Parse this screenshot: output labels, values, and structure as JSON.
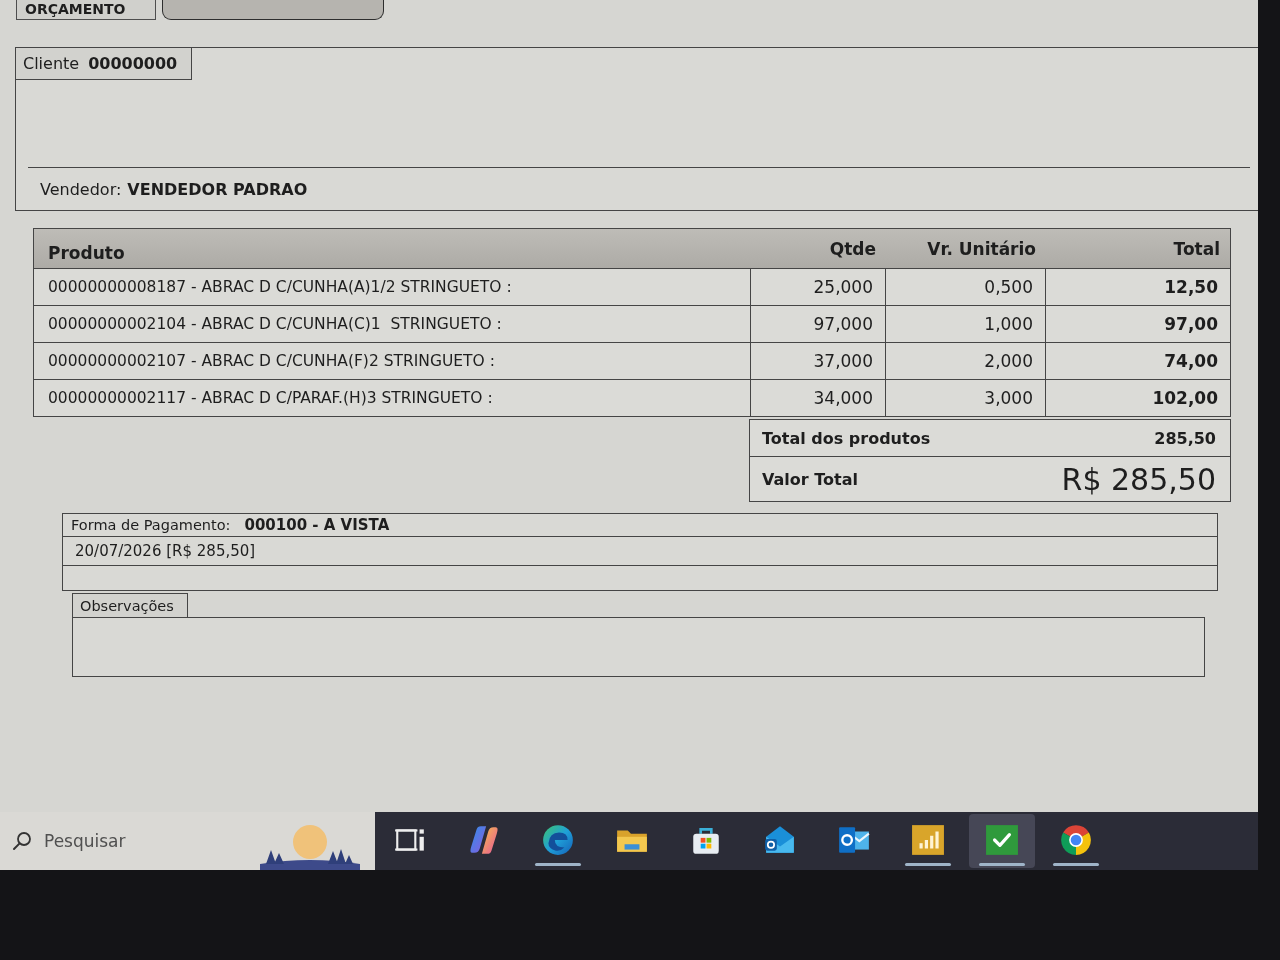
{
  "tabs": [
    {
      "label": "ORÇAMENTO",
      "selected": false
    },
    {
      "selected": true
    }
  ],
  "cliente": {
    "label": "Cliente",
    "code": "00000000"
  },
  "vendedor": {
    "label": "Vendedor:",
    "name": "VENDEDOR PADRAO"
  },
  "products_table": {
    "columns": [
      "Produto",
      "Qtde",
      "Vr. Unitário",
      "Total"
    ],
    "rows": [
      [
        "00000000008187 - ABRAC D C/CUNHA(A)1/2 STRINGUETO :",
        "25,000",
        "0,500",
        "12,50"
      ],
      [
        "00000000002104 - ABRAC D C/CUNHA(C)1  STRINGUETO :",
        "97,000",
        "1,000",
        "97,00"
      ],
      [
        "00000000002107 - ABRAC D C/CUNHA(F)2 STRINGUETO :",
        "37,000",
        "2,000",
        "74,00"
      ],
      [
        "00000000002117 - ABRAC D C/PARAF.(H)3 STRINGUETO :",
        "34,000",
        "3,000",
        "102,00"
      ]
    ]
  },
  "totals": [
    {
      "kind": "subtotal",
      "label": "Total dos produtos",
      "value": "285,50"
    },
    {
      "kind": "grand",
      "label": "Valor Total",
      "value": "R$ 285,50"
    }
  ],
  "payment": {
    "label": "Forma de Pagamento:",
    "method": "000100 - A VISTA",
    "installments": [
      "20/07/2026 [R$ 285,50]"
    ]
  },
  "observacoes": {
    "label": "Observações"
  },
  "taskbar": {
    "search": {
      "placeholder": "Pesquisar"
    },
    "apps": [
      {
        "kind": "taskview",
        "running": false,
        "selected": false
      },
      {
        "kind": "copilot",
        "running": false,
        "selected": false
      },
      {
        "kind": "edge",
        "running": true,
        "selected": false
      },
      {
        "kind": "explorer",
        "running": false,
        "selected": false
      },
      {
        "kind": "store",
        "running": false,
        "selected": false
      },
      {
        "kind": "outlook_new",
        "running": false,
        "selected": false
      },
      {
        "kind": "outlook",
        "running": false,
        "selected": false
      },
      {
        "kind": "chart_app",
        "running": true,
        "selected": false
      },
      {
        "kind": "check_app",
        "running": true,
        "selected": true
      },
      {
        "kind": "chrome",
        "running": true,
        "selected": false
      }
    ]
  }
}
